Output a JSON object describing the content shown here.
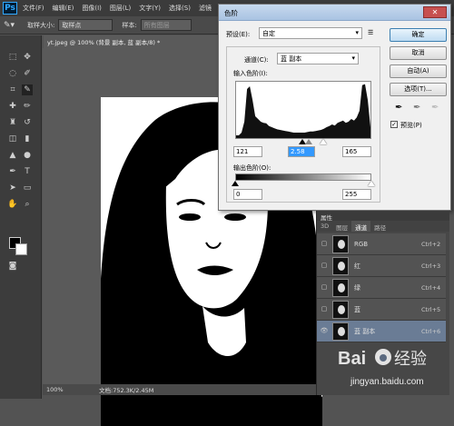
{
  "app": {
    "logo": "Ps"
  },
  "menu": [
    "文件(F)",
    "编辑(E)",
    "图像(I)",
    "图层(L)",
    "文字(Y)",
    "选择(S)",
    "滤镜"
  ],
  "options": {
    "sample_size_label": "取样大小:",
    "sample_size_value": "取样点",
    "sample_label": "样本:",
    "sample_value": "所有图层"
  },
  "document_tab": "yt.jpeg @ 100% (背景 副本, 蓝 副本/8) *",
  "status": {
    "zoom": "100%",
    "doc_info": "文档:752.3K/2.45M"
  },
  "levels_dialog": {
    "title": "色阶",
    "close_glyph": "✕",
    "preset_label": "预设(E):",
    "preset_value": "自定",
    "channel_label": "通道(C):",
    "channel_value": "蓝 副本",
    "input_levels_label": "输入色阶(I):",
    "input_black": "121",
    "input_gamma": "2.58",
    "input_white": "165",
    "output_levels_label": "输出色阶(O):",
    "output_black": "0",
    "output_white": "255",
    "buttons": {
      "ok": "确定",
      "cancel": "取消",
      "auto": "自动(A)",
      "options": "选项(T)..."
    },
    "preview_label": "预览(P)",
    "preview_checked": true,
    "histogram_peaks": [
      0.05,
      0.05,
      0.1,
      0.3,
      0.9,
      0.95,
      0.7,
      0.4,
      0.35,
      0.3,
      0.28,
      0.27,
      0.22,
      0.2,
      0.18,
      0.16,
      0.15,
      0.14,
      0.13,
      0.12,
      0.11,
      0.1,
      0.1,
      0.1,
      0.1,
      0.1,
      0.11,
      0.12,
      0.12,
      0.13,
      0.14,
      0.15,
      0.17,
      0.2,
      0.22,
      0.25,
      0.23,
      0.28,
      0.3,
      0.32,
      0.28,
      0.3,
      0.35,
      0.32,
      0.38,
      0.5,
      0.97,
      0.99,
      0.7,
      0.2
    ]
  },
  "channels_panel": {
    "header": "属性",
    "tabs": [
      "3D",
      "图层",
      "通道",
      "路径"
    ],
    "active_tab": 2,
    "channels": [
      {
        "name": "RGB",
        "shortcut": "Ctrl+2",
        "visible": false
      },
      {
        "name": "红",
        "shortcut": "Ctrl+3",
        "visible": false
      },
      {
        "name": "绿",
        "shortcut": "Ctrl+4",
        "visible": false
      },
      {
        "name": "蓝",
        "shortcut": "Ctrl+5",
        "visible": false
      },
      {
        "name": "蓝 副本",
        "shortcut": "Ctrl+6",
        "visible": true
      }
    ]
  },
  "watermark": {
    "brand": "Bai",
    "brand2": "经验",
    "url": "jingyan.baidu.com"
  }
}
